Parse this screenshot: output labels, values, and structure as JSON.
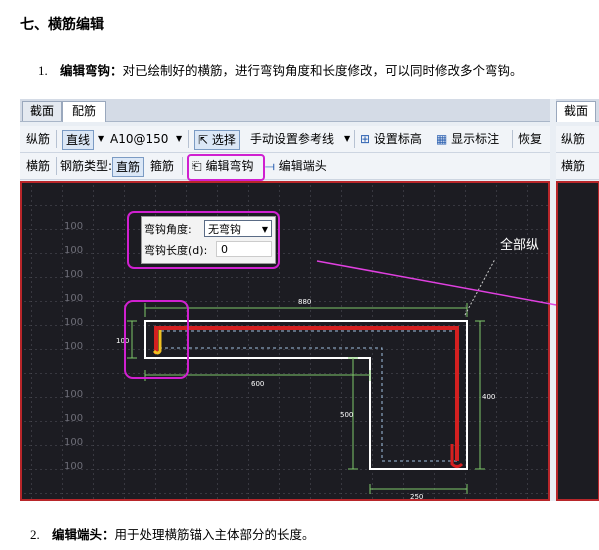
{
  "section_title": "七、横筋编辑",
  "item1": {
    "number": "1.",
    "term": "编辑弯钩：",
    "text": "对已绘制好的横筋，进行弯钩角度和长度修改，可以同时修改多个弯钩。"
  },
  "item2": {
    "number": "2.",
    "term": "编辑端头：",
    "text": "用于处理横筋锚入主体部分的长度。"
  },
  "screenshot": {
    "tabs": [
      "截面",
      "配筋"
    ],
    "right_tab": "截面",
    "toolbar1": {
      "vertical_rebar": "纵筋",
      "line_mode": "直线",
      "rebar_spec": "A10@150",
      "select": "选择",
      "manual_ref": "手动设置参考线",
      "set_elevation": "设置标高",
      "show_label": "显示标注",
      "restore": "恢复"
    },
    "toolbar2": {
      "horizontal_rebar": "横筋",
      "rebar_type_label": "钢筋类型:",
      "straight": "直筋",
      "stirrup": "箍筋",
      "edit_hook": "编辑弯钩",
      "edit_end": "编辑端头"
    },
    "right_toolbar": [
      "纵筋",
      "横筋"
    ],
    "dialog": {
      "hook_angle_label": "弯钩角度:",
      "hook_angle_value": "无弯钩",
      "hook_length_label": "弯钩长度(d):",
      "hook_length_value": "0"
    },
    "callout": "全部纵",
    "grid_labels": [
      "100",
      "100",
      "100",
      "100",
      "100",
      "100",
      "100",
      "100",
      "100",
      "100"
    ],
    "dimensions": {
      "top": "880",
      "left": "100",
      "middle": "600",
      "vertical_mid": "500",
      "vertical_right": "400",
      "bottom": "250"
    },
    "colors": {
      "highlight": "#d020d0",
      "rebar": "#d42020",
      "hook": "#f0c020",
      "dimension": "#7ec86a",
      "arrow": "#e040e0"
    }
  }
}
